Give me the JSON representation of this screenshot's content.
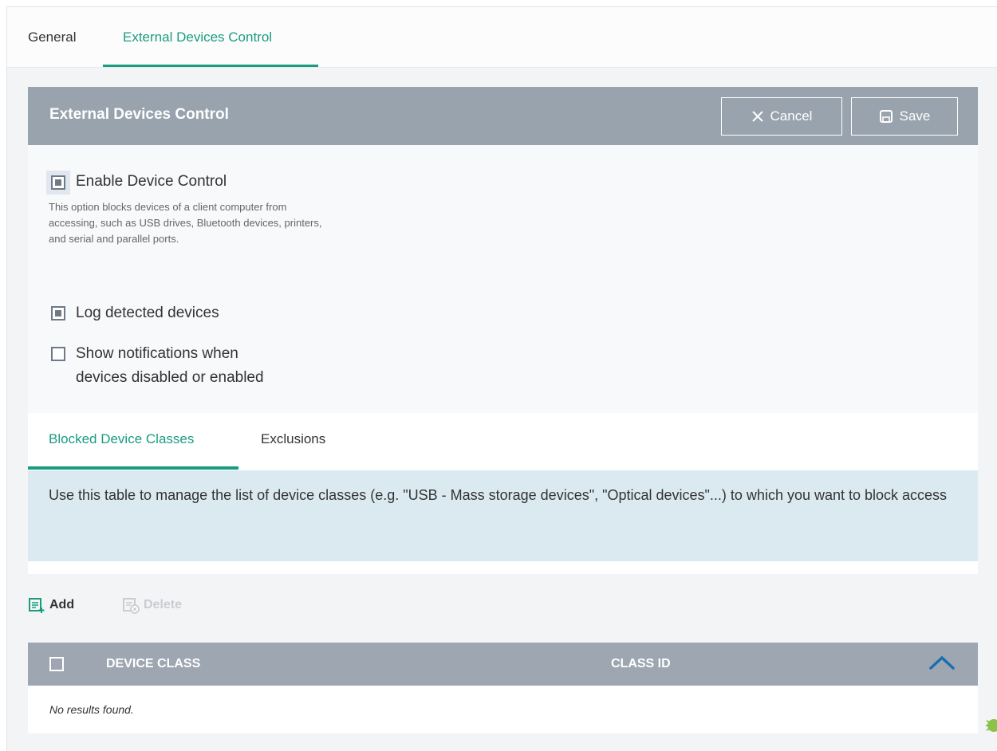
{
  "tabs": {
    "general": "General",
    "external": "External Devices Control"
  },
  "panel": {
    "title": "External Devices Control",
    "cancel_label": "Cancel",
    "save_label": "Save"
  },
  "options": {
    "enable_device_control": {
      "label": "Enable Device Control",
      "checked": true,
      "description": "This option blocks devices of a client computer from accessing, such as USB drives, Bluetooth devices, printers, and serial and parallel ports."
    },
    "log_detected": {
      "label": "Log detected devices",
      "checked": true
    },
    "show_notifications": {
      "label_line1": "Show notifications when",
      "label_line2": "devices disabled or enabled",
      "checked": false
    }
  },
  "sub_tabs": {
    "blocked": "Blocked Device Classes",
    "exclusions": "Exclusions"
  },
  "info_text": "Use this table to manage the list of device classes (e.g. \"USB - Mass storage devices\", \"Optical devices\"...) to which you want to block access",
  "toolbar": {
    "add_label": "Add",
    "delete_label": "Delete"
  },
  "table": {
    "columns": [
      "DEVICE CLASS",
      "CLASS ID"
    ],
    "empty_text": "No results found."
  },
  "colors": {
    "accent": "#1a9c7f",
    "header_bg": "#98a3ad",
    "info_bg": "#dbeaf1"
  }
}
